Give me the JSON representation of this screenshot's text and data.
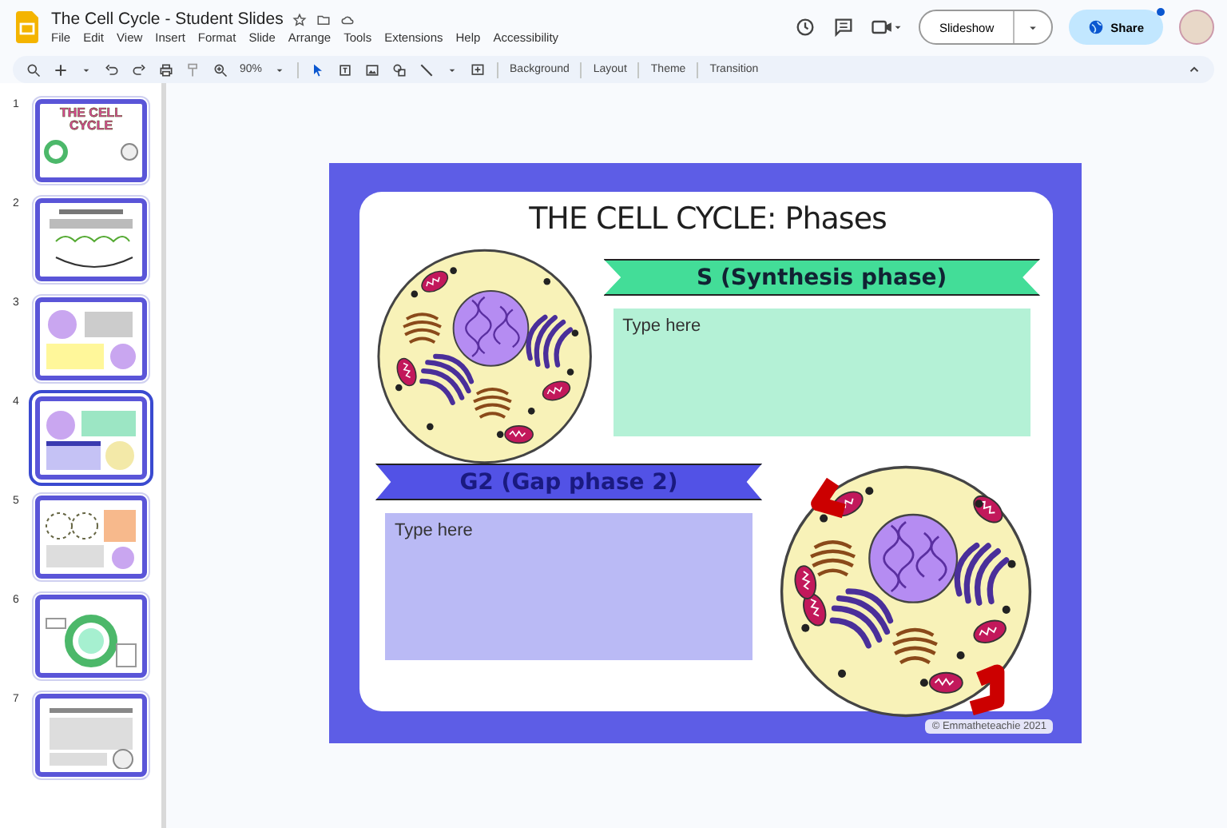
{
  "window": {
    "title": "The Cell Cycle - Student Slides"
  },
  "menu": [
    "File",
    "Edit",
    "View",
    "Insert",
    "Format",
    "Slide",
    "Arrange",
    "Tools",
    "Extensions",
    "Help",
    "Accessibility"
  ],
  "header_actions": {
    "slideshow": "Slideshow",
    "share": "Share"
  },
  "toolbar": {
    "zoom": "90%",
    "buttons": [
      "Background",
      "Layout",
      "Theme",
      "Transition"
    ]
  },
  "thumbnails": [
    {
      "number": "1",
      "kind": "title",
      "title": "THE CELL CYCLE",
      "selected": false
    },
    {
      "number": "2",
      "kind": "intro",
      "selected": false
    },
    {
      "number": "3",
      "kind": "yellow",
      "selected": false
    },
    {
      "number": "4",
      "kind": "phases",
      "selected": true
    },
    {
      "number": "5",
      "kind": "orange",
      "selected": false
    },
    {
      "number": "6",
      "kind": "diagram",
      "selected": false
    },
    {
      "number": "7",
      "kind": "text",
      "selected": false
    }
  ],
  "slide": {
    "title": "THE CELL CYCLE: Phases",
    "sections": [
      {
        "heading": "S (Synthesis phase)",
        "body": "Type here",
        "color": "#43dd98"
      },
      {
        "heading": "G2 (Gap phase 2)",
        "body": "Type here",
        "color": "#5252e6"
      }
    ],
    "copyright": "© Emmatheteachie 2021"
  }
}
